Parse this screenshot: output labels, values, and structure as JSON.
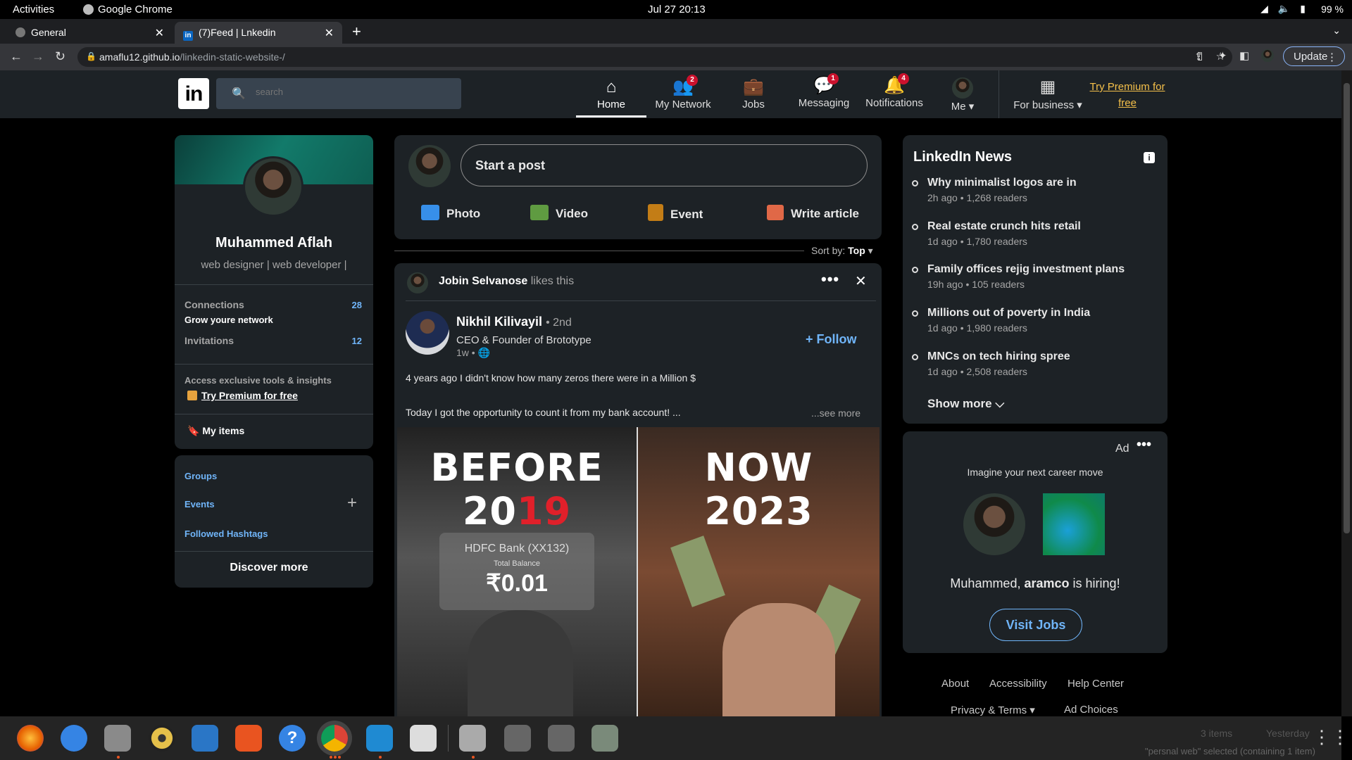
{
  "system_bar": {
    "activities": "Activities",
    "app_name": "Google Chrome",
    "clock": "Jul 27  20:13",
    "battery": "99 %"
  },
  "browser": {
    "tabs": [
      {
        "title": "General"
      },
      {
        "title": "(7)Feed | Lnkedin"
      }
    ],
    "url_host": "amaflu12.github.io",
    "url_path": "/linkedin-static-website-/",
    "update_label": "Update"
  },
  "navbar": {
    "search_placeholder": "search",
    "items": [
      {
        "label": "Home",
        "badge": ""
      },
      {
        "label": "My Network",
        "badge": "2"
      },
      {
        "label": "Jobs",
        "badge": ""
      },
      {
        "label": "Messaging",
        "badge": "1"
      },
      {
        "label": "Notifications",
        "badge": "4"
      },
      {
        "label": "Me",
        "badge": ""
      },
      {
        "label": "For business",
        "badge": ""
      }
    ],
    "premium_link": "Try Premium for free"
  },
  "profile": {
    "name": "Muhammed Aflah",
    "headline": "web designer | web developer |",
    "connections_label": "Connections",
    "connections_count": "28",
    "grow_label": "Grow youre network",
    "invitations_label": "Invitations",
    "invitations_count": "12",
    "premium_text": "Access exclusive tools & insights",
    "premium_link": "Try Premium for free",
    "my_items": "My items"
  },
  "discover": {
    "groups": "Groups",
    "events": "Events",
    "hashtags": "Followed Hashtags",
    "discover_more": "Discover more"
  },
  "composer": {
    "start_post": "Start a post",
    "actions": [
      {
        "label": "Photo",
        "color": "#378fe9"
      },
      {
        "label": "Video",
        "color": "#5f9b41"
      },
      {
        "label": "Event",
        "color": "#c37d16"
      },
      {
        "label": "Write article",
        "color": "#e06847"
      }
    ]
  },
  "sort": {
    "label": "Sort by:",
    "value": "Top"
  },
  "post": {
    "liker_name": "Jobin Selvanose",
    "liker_action": "likes this",
    "author_name": "Nikhil Kilivayil",
    "author_degree": "• 2nd",
    "author_title": "CEO & Founder of Brototype",
    "time": "1w •",
    "follow_label": "Follow",
    "text_line1": "4 years ago I didn't know how many zeros there were in a Million $",
    "text_line2": "Today I got the opportunity to count it from my bank account! ...",
    "see_more": "...see more",
    "image_before": {
      "line1": "BEFORE",
      "line2_a": "20",
      "line2_b": "19",
      "bank": "HDFC Bank (XX132)",
      "balance_label": "Total Balance",
      "balance": "₹0.01"
    },
    "image_now": {
      "line1": "NOW",
      "line2": "2023"
    }
  },
  "news": {
    "title": "LinkedIn News",
    "items": [
      {
        "title": "Why minimalist logos are in",
        "meta": "2h ago • 1,268 readers"
      },
      {
        "title": "Real estate crunch hits retail",
        "meta": "1d ago • 1,780 readers"
      },
      {
        "title": "Family offices rejig investment plans",
        "meta": "19h ago • 105 readers"
      },
      {
        "title": "Millions out of poverty in India",
        "meta": "1d ago • 1,980 readers"
      },
      {
        "title": "MNCs on tech hiring spree",
        "meta": "1d ago • 2,508 readers"
      }
    ],
    "show_more": "Show more"
  },
  "ad": {
    "label": "Ad",
    "headline": "Imagine your next career move",
    "hiring_name": "Muhammed,",
    "hiring_company": "aramco",
    "hiring_suffix": "is hiring!",
    "cta": "Visit Jobs"
  },
  "footer": {
    "links": [
      "About",
      "Accessibility",
      "Help Center",
      "Privacy & Terms",
      "Ad Choices"
    ]
  },
  "dock_status": {
    "items": "3 items",
    "yesterday": "Yesterday",
    "selection": "\"persnal web\" selected (containing 1 item)"
  },
  "icons": {
    "home": "house-icon",
    "network": "people-icon",
    "jobs": "briefcase-icon",
    "messaging": "chat-icon",
    "notifications": "bell-icon",
    "business": "grid-icon"
  }
}
